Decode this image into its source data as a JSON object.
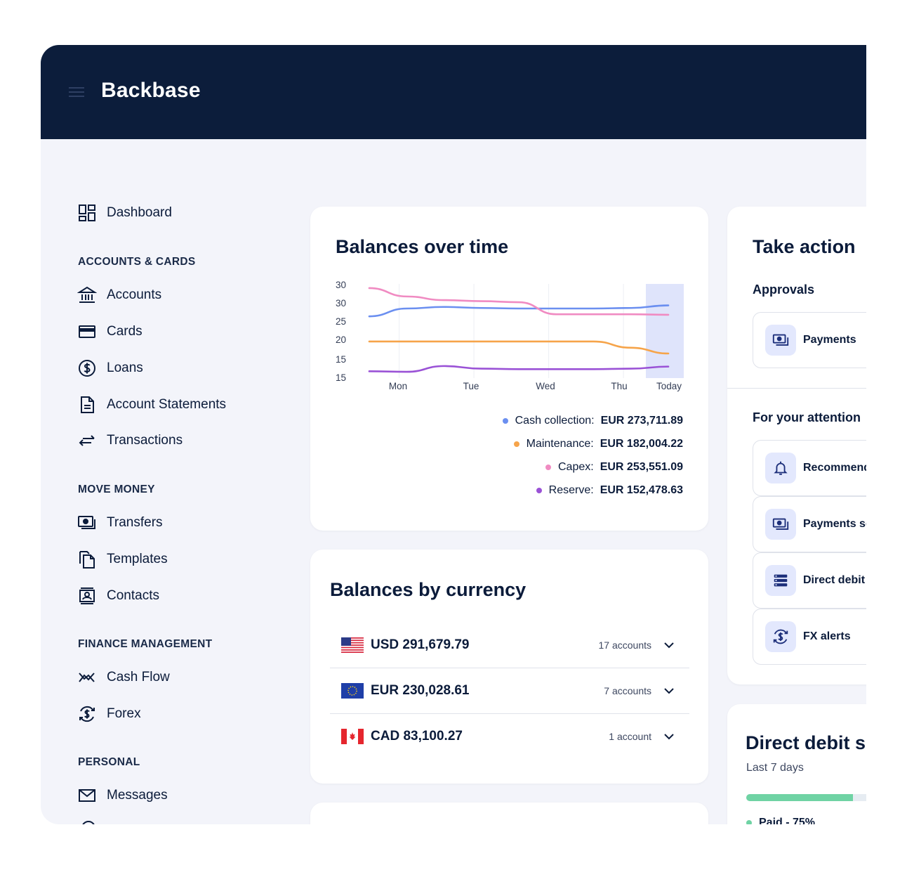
{
  "brand": {
    "logo": "Backbase"
  },
  "sidebar": {
    "dashboard": "Dashboard",
    "sections": [
      {
        "heading": "ACCOUNTS & CARDS",
        "items": [
          "Accounts",
          "Cards",
          "Loans",
          "Account Statements",
          "Transactions"
        ]
      },
      {
        "heading": "MOVE MONEY",
        "items": [
          "Transfers",
          "Templates",
          "Contacts"
        ]
      },
      {
        "heading": "FINANCE MANAGEMENT",
        "items": [
          "Cash Flow",
          "Forex"
        ]
      },
      {
        "heading": "PERSONAL",
        "items": [
          "Messages"
        ]
      }
    ]
  },
  "balances_over_time": {
    "title": "Balances over time",
    "legend": [
      {
        "label": "Cash collection:",
        "value": "EUR 273,711.89",
        "color": "#6b8ff0"
      },
      {
        "label": "Maintenance:",
        "value": "EUR 182,004.22",
        "color": "#f6a44a"
      },
      {
        "label": "Capex:",
        "value": "EUR 253,551.09",
        "color": "#f08bc2"
      },
      {
        "label": "Reserve:",
        "value": "EUR 152,478.63",
        "color": "#9a52d6"
      }
    ]
  },
  "chart_data": {
    "type": "line",
    "categories": [
      "Mon",
      "Tue",
      "Wed",
      "Thu",
      "Today"
    ],
    "y_tick_labels": [
      "30",
      "30",
      "25",
      "20",
      "15",
      "15"
    ],
    "ylim": [
      13,
      31
    ],
    "highlight_category": "Today",
    "grid": "vertical",
    "x": [
      0,
      0.5,
      1,
      1.5,
      2,
      2.5,
      3,
      3.5,
      4
    ],
    "series": [
      {
        "name": "Cash collection",
        "color": "#6b8ff0",
        "values": [
          24.8,
          26.3,
          26.6,
          26.4,
          26.3,
          26.3,
          26.3,
          26.4,
          26.9
        ]
      },
      {
        "name": "Maintenance",
        "color": "#f6a44a",
        "values": [
          20.0,
          20.0,
          20.0,
          20.0,
          20.0,
          20.0,
          20.0,
          18.8,
          17.7
        ]
      },
      {
        "name": "Capex",
        "color": "#f08bc2",
        "values": [
          30.2,
          28.6,
          27.9,
          27.7,
          27.5,
          25.2,
          25.2,
          25.2,
          25.1
        ]
      },
      {
        "name": "Reserve",
        "color": "#9a52d6",
        "values": [
          14.3,
          14.2,
          15.3,
          14.8,
          14.7,
          14.7,
          14.7,
          14.8,
          15.2
        ]
      }
    ]
  },
  "balances_by_currency": {
    "title": "Balances by currency",
    "rows": [
      {
        "flag": "us-flag",
        "amount": "USD 291,679.79",
        "accounts": "17 accounts"
      },
      {
        "flag": "eu-flag",
        "amount": "EUR 230,028.61",
        "accounts": "7 accounts"
      },
      {
        "flag": "ca-flag",
        "amount": "CAD 83,100.27",
        "accounts": "1 account"
      }
    ]
  },
  "take_action": {
    "title": "Take action",
    "approvals_heading": "Approvals",
    "approvals": [
      {
        "label": "Payments",
        "icon": "money-icon"
      }
    ],
    "attention_heading": "For your attention",
    "attention": [
      {
        "label": "Recommend",
        "icon": "bell-icon"
      },
      {
        "label": "Payments sc",
        "icon": "money-icon"
      },
      {
        "label": "Direct debit",
        "icon": "server-list-icon"
      },
      {
        "label": "FX alerts",
        "icon": "currency-exchange-icon"
      }
    ]
  },
  "direct_debit": {
    "title": "Direct debit s",
    "subtitle": "Last 7 days",
    "paid_label": "Paid - 75%",
    "paid_fraction": 0.75,
    "paid_color": "#6fd3a4"
  }
}
